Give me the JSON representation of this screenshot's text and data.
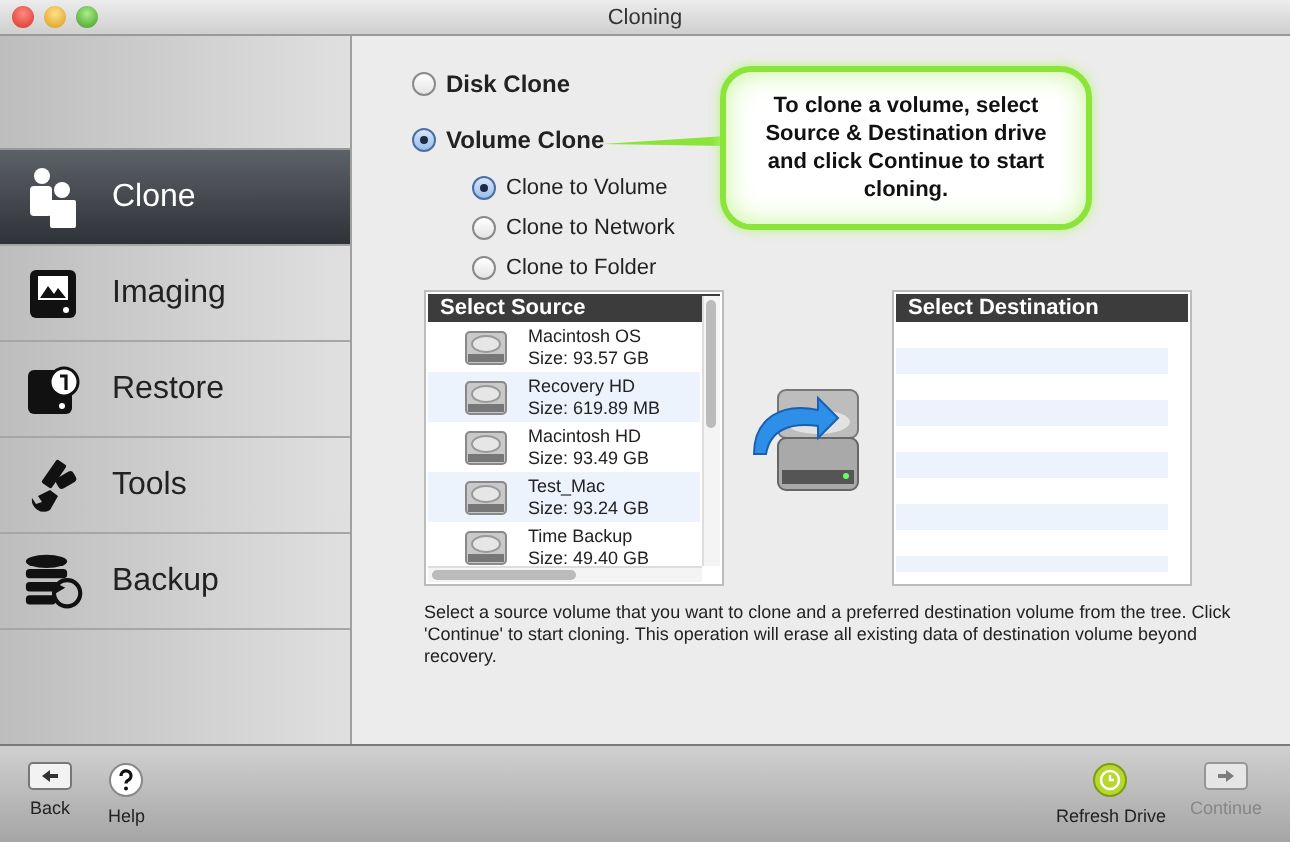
{
  "window": {
    "title": "Cloning"
  },
  "sidebar": {
    "items": [
      {
        "label": "Clone",
        "selected": true
      },
      {
        "label": "Imaging",
        "selected": false
      },
      {
        "label": "Restore",
        "selected": false
      },
      {
        "label": "Tools",
        "selected": false
      },
      {
        "label": "Backup",
        "selected": false
      }
    ]
  },
  "clone_modes": [
    {
      "label": "Disk Clone",
      "selected": false
    },
    {
      "label": "Volume Clone",
      "selected": true
    }
  ],
  "volume_options": [
    {
      "label": "Clone to Volume",
      "selected": true
    },
    {
      "label": "Clone to Network",
      "selected": false
    },
    {
      "label": "Clone to Folder",
      "selected": false
    }
  ],
  "callout": {
    "text": "To clone a volume, select Source & Destination drive and click Continue to start cloning."
  },
  "source": {
    "title": "Select Source",
    "volumes": [
      {
        "name": "Macintosh OS",
        "size": "Size: 93.57 GB"
      },
      {
        "name": "Recovery HD",
        "size": "Size: 619.89 MB"
      },
      {
        "name": "Macintosh HD",
        "size": "Size: 93.49 GB"
      },
      {
        "name": "Test_Mac",
        "size": "Size: 93.24 GB"
      },
      {
        "name": "Time Backup",
        "size": "Size: 49.40 GB"
      }
    ]
  },
  "destination": {
    "title": "Select Destination"
  },
  "description": "Select a source volume that you want to clone and a preferred destination volume from the tree. Click 'Continue' to start cloning. This operation will erase all existing data of destination volume beyond recovery.",
  "footer": {
    "left": [
      {
        "label": "Back",
        "kind": "back",
        "disabled": false
      },
      {
        "label": "Help",
        "kind": "help",
        "disabled": false
      }
    ],
    "right": [
      {
        "label": "Refresh Drive",
        "kind": "refresh",
        "disabled": false
      },
      {
        "label": "Continue",
        "kind": "continue",
        "disabled": true
      }
    ]
  }
}
